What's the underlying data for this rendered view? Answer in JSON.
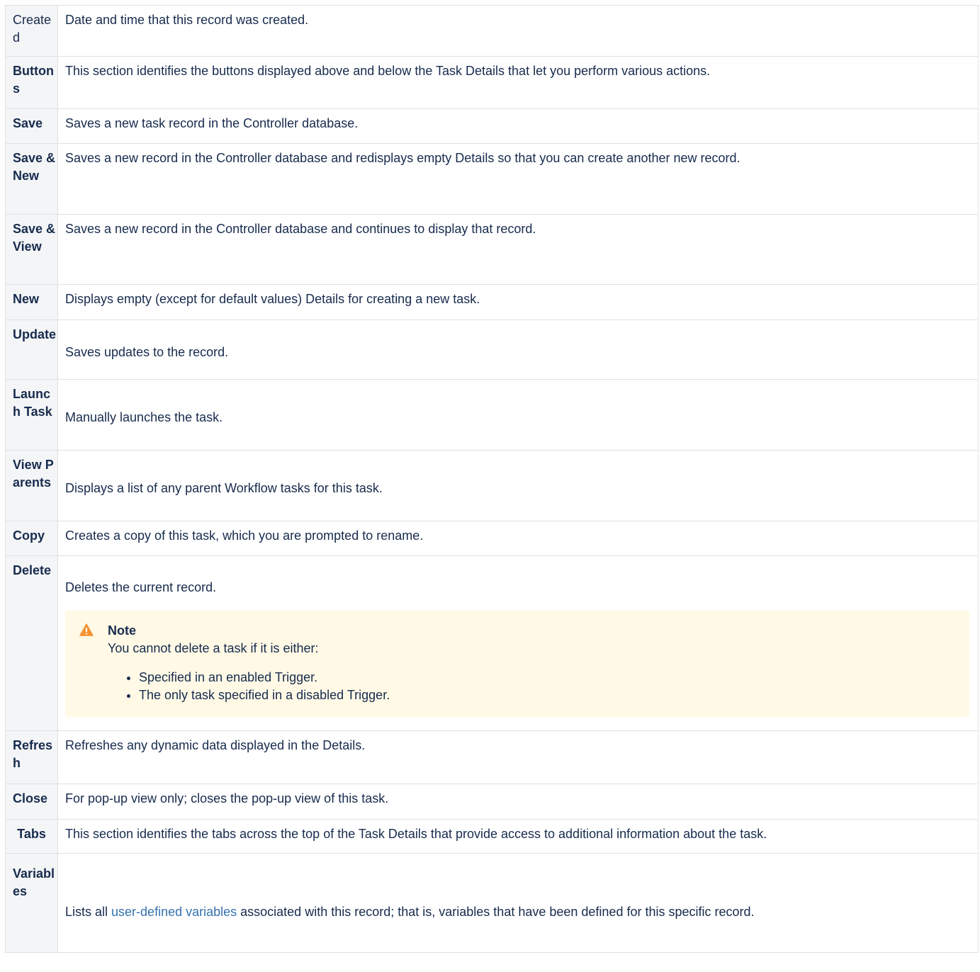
{
  "rows": {
    "created": {
      "label": "Created",
      "desc": "Date and time that this record was created."
    },
    "buttons": {
      "label": "Buttons",
      "desc": "This section identifies the buttons displayed above and below the Task Details that let you perform various actions."
    },
    "save": {
      "label": "Save",
      "desc": "Saves a new task record in the Controller database."
    },
    "save_new": {
      "label": "Save & New",
      "desc": "Saves a new record in the Controller database and redisplays empty Details so that you can create another new record."
    },
    "save_view": {
      "label": "Save & View",
      "desc": "Saves a new record in the Controller database and continues to display that record."
    },
    "new": {
      "label": "New",
      "desc": "Displays empty (except for default values) Details for creating a new task."
    },
    "update": {
      "label": "Update",
      "desc": "Saves updates to the record."
    },
    "launch_task": {
      "label": "Launch Task",
      "desc": "Manually launches the task."
    },
    "view_parents": {
      "label": "View Parents",
      "desc": "Displays a list of any parent Workflow tasks for this task."
    },
    "copy": {
      "label": "Copy",
      "desc": "Creates a copy of this task, which you are prompted to rename."
    },
    "delete": {
      "label": "Delete",
      "desc": "Deletes the current record.",
      "note": {
        "icon": "warning-icon",
        "title": "Note",
        "text": "You cannot delete a task if it is either:",
        "items": [
          "Specified in an enabled Trigger.",
          "The only task specified in a disabled Trigger."
        ]
      }
    },
    "refresh": {
      "label": "Refresh",
      "desc": "Refreshes any dynamic data displayed in the Details."
    },
    "close": {
      "label": "Close",
      "desc": "For pop-up view only; closes the pop-up view of this task."
    },
    "tabs": {
      "label": "Tabs",
      "desc": "This section identifies the tabs across the top of the Task Details that provide access to additional information about the task."
    },
    "variables": {
      "label": "Variables",
      "desc_link": "user-defined variables",
      "desc_before": "Lists all ",
      "desc_after": " associated with this record; that is, variables that have been defined for this specific record."
    }
  },
  "colors": {
    "header_bg": "#f4f5f7",
    "border": "#dfe1e6",
    "note_bg": "#fff9e6",
    "warning": "#f79232",
    "link": "#3572b0"
  }
}
